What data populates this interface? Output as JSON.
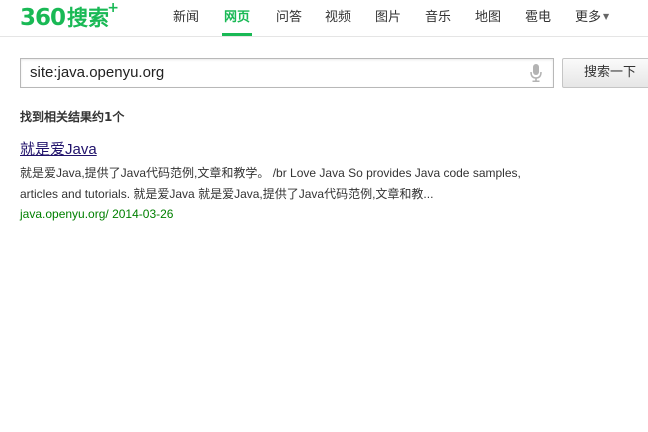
{
  "logo": {
    "digits": "360",
    "text": "搜索",
    "plus": "+"
  },
  "nav": {
    "items": [
      {
        "label": "新闻"
      },
      {
        "label": "网页"
      },
      {
        "label": "问答"
      },
      {
        "label": "视频"
      },
      {
        "label": "图片"
      },
      {
        "label": "音乐"
      },
      {
        "label": "地图"
      },
      {
        "label": "雹电"
      },
      {
        "label": "更多"
      }
    ],
    "active": "网页"
  },
  "search": {
    "query": "site:java.openyu.org",
    "button_label": "搜索一下"
  },
  "results_summary": "找到相关结果约1个",
  "results": [
    {
      "title": "就是爱Java",
      "snippet_line1": "就是爱Java,提供了Java代码范例,文章和教学。 /br Love Java So provides Java code samples,",
      "snippet_line2": "articles and tutorials. 就是爱Java 就是爱Java,提供了Java代码范例,文章和教...",
      "url": "java.openyu.org/",
      "date": "2014-03-26"
    }
  ],
  "colors": {
    "brand_green": "#19b955",
    "link": "#20126b",
    "url_green": "#008000"
  },
  "icons": {
    "mic": "microphone-icon",
    "more": "chevron-down-icon"
  }
}
